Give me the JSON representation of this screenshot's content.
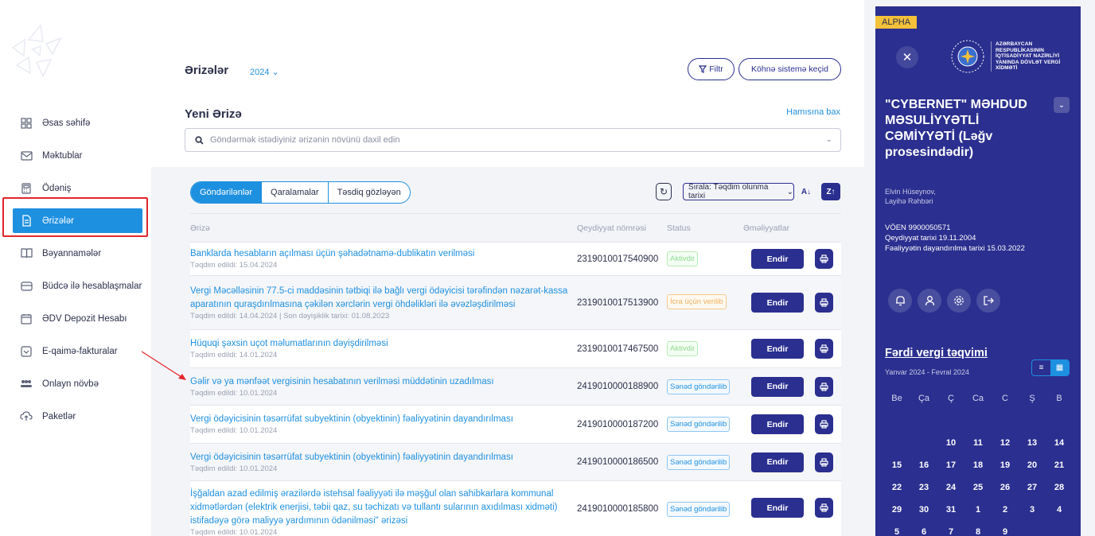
{
  "sidebar": {
    "items": [
      {
        "label": "Əsas səhifə",
        "icon": "grid-icon"
      },
      {
        "label": "Məktublar",
        "icon": "mail-icon"
      },
      {
        "label": "Ödəniş",
        "icon": "calculator-icon"
      },
      {
        "label": "Ərizələr",
        "icon": "document-icon"
      },
      {
        "label": "Bəyannamələr",
        "icon": "book-icon"
      },
      {
        "label": "Büdcə ilə hesablaşmalar",
        "icon": "wallet-icon"
      },
      {
        "label": "ƏDV Depozit Hesabı",
        "icon": "calendar-icon"
      },
      {
        "label": "E-qaimə-fakturalar",
        "icon": "invoice-icon"
      },
      {
        "label": "Onlayn növbə",
        "icon": "people-icon"
      },
      {
        "label": "Paketlər",
        "icon": "cloud-icon"
      }
    ]
  },
  "header": {
    "title": "Ərizələr",
    "year": "2024 ⌄",
    "filter_label": "Filtr",
    "old_system_label": "Köhnə sistemə keçid"
  },
  "new_application": {
    "title": "Yeni Ərizə",
    "see_all": "Hamısına bax",
    "search_placeholder": "Göndərmək istədiyiniz ərizənin növünü daxil edin"
  },
  "tabs": [
    "Göndərilənlər",
    "Qaralamalar",
    "Təsdiq gözləyən"
  ],
  "sort": {
    "label": "Sırala: Təqdim olunma tarixi"
  },
  "table": {
    "headers": [
      "Ərizə",
      "Qeydiyyat nömrəsi",
      "Status",
      "Əməliyyatlar"
    ],
    "download_label": "Endir",
    "rows": [
      {
        "title": "Banklarda hesabların açılması üçün şəhadətnamə-dublikatın verilməsi",
        "sub": "Təqdim edildi: 15.04.2024",
        "reg": "2319010017540900",
        "status": "Aktivdir",
        "status_color": "green"
      },
      {
        "title": "Vergi Məcəlləsinin 77.5-ci maddəsinin tətbiqi ilə bağlı vergi ödəyicisi tərəfindən nəzarət-kassa aparatının quraşdırılmasına çəkilən xərclərin vergi öhdəlikləri ilə əvəzləşdirilməsi",
        "sub": "Təqdim edildi: 14.04.2024 | Son dəyişiklik tarixi: 01.08.2023",
        "reg": "2319010017513900",
        "status": "İcra üçün verilib",
        "status_color": "orange"
      },
      {
        "title": "Hüquqi şəxsin uçot məlumatlarının dəyişdirilməsi",
        "sub": "Təqdim edildi: 14.01.2024",
        "reg": "2319010017467500",
        "status": "Aktivdir",
        "status_color": "green"
      },
      {
        "title": "Gəlir və ya mənfəət vergisinin hesabatının verilməsi müddətinin uzadılması",
        "sub": "Təqdim edildi: 10.01.2024",
        "reg": "2419010000188900",
        "status": "Sənəd göndərilib",
        "status_color": "blue"
      },
      {
        "title": "Vergi ödəyicisinin təsərrüfat subyektinin (obyektinin) fəaliyyətinin dayandırılması",
        "sub": "Təqdim edildi: 10.01.2024",
        "reg": "2419010000187200",
        "status": "Sənəd göndərilib",
        "status_color": "blue"
      },
      {
        "title": "Vergi ödəyicisinin təsərrüfat subyektinin (obyektinin) fəaliyyətinin dayandırılması",
        "sub": "Təqdim edildi: 10.01.2024",
        "reg": "2419010000186500",
        "status": "Sənəd göndərilib",
        "status_color": "blue"
      },
      {
        "title": "İşğaldan azad edilmiş ərazilərdə istehsal fəaliyyəti ilə məşğul olan sahibkarlara kommunal xidmətlərdən (elektrik enerjisi, təbii qaz, su təchizatı və tullantı sularının axıdılması xidməti) istifadəyə görə maliyyə yardımının ödənilməsi\" ərizəsi",
        "sub": "Təqdim edildi: 10.01.2024",
        "reg": "2419010000185800",
        "status": "Sənəd göndərilib",
        "status_color": "blue"
      }
    ]
  },
  "panel": {
    "badge": "ALPHA",
    "ministry": [
      "AZƏRBAYCAN",
      "RESPUBLİKASININ",
      "İQTİSADİYYAT NAZİRLİYİ",
      "YANINDA DÖVLƏT VERGİ",
      "XİDMƏTİ"
    ],
    "company": "\"CYBERNET\" MƏHDUD MƏSULİYYƏTLİ CƏMİYYƏTİ (Ləğv prosesindədir)",
    "person_name": "Elvin Hüseynov,",
    "person_role": "Layihə Rəhbəri",
    "voen": "VÖEN 9900050571",
    "registration": "Qeydiyyat tarixi 19.11.2004",
    "suspension": "Fəaliyyətin dayandırılma tarixi 15.03.2022",
    "calendar_title": "Fərdi vergi təqvimi",
    "calendar_range": "Yanvar 2024 - Fevral 2024",
    "weekdays": [
      "Be",
      "Ça",
      "Ç",
      "Ca",
      "C",
      "Ş",
      "B"
    ],
    "weeks": [
      [
        "",
        "",
        "",
        "",
        "",
        "",
        ""
      ],
      [
        "",
        "",
        "10",
        "11",
        "12",
        "13",
        "14"
      ],
      [
        "15",
        "16",
        "17",
        "18",
        "19",
        "20",
        "21"
      ],
      [
        "22",
        "23",
        "24",
        "25",
        "26",
        "27",
        "28"
      ],
      [
        "29",
        "30",
        "31",
        "1",
        "2",
        "3",
        "4"
      ],
      [
        "5",
        "6",
        "7",
        "8",
        "9",
        "",
        ""
      ]
    ]
  },
  "colors": {
    "accent": "#1e90e0",
    "navy": "#2b2f8f",
    "highlight": "#e3262b"
  }
}
